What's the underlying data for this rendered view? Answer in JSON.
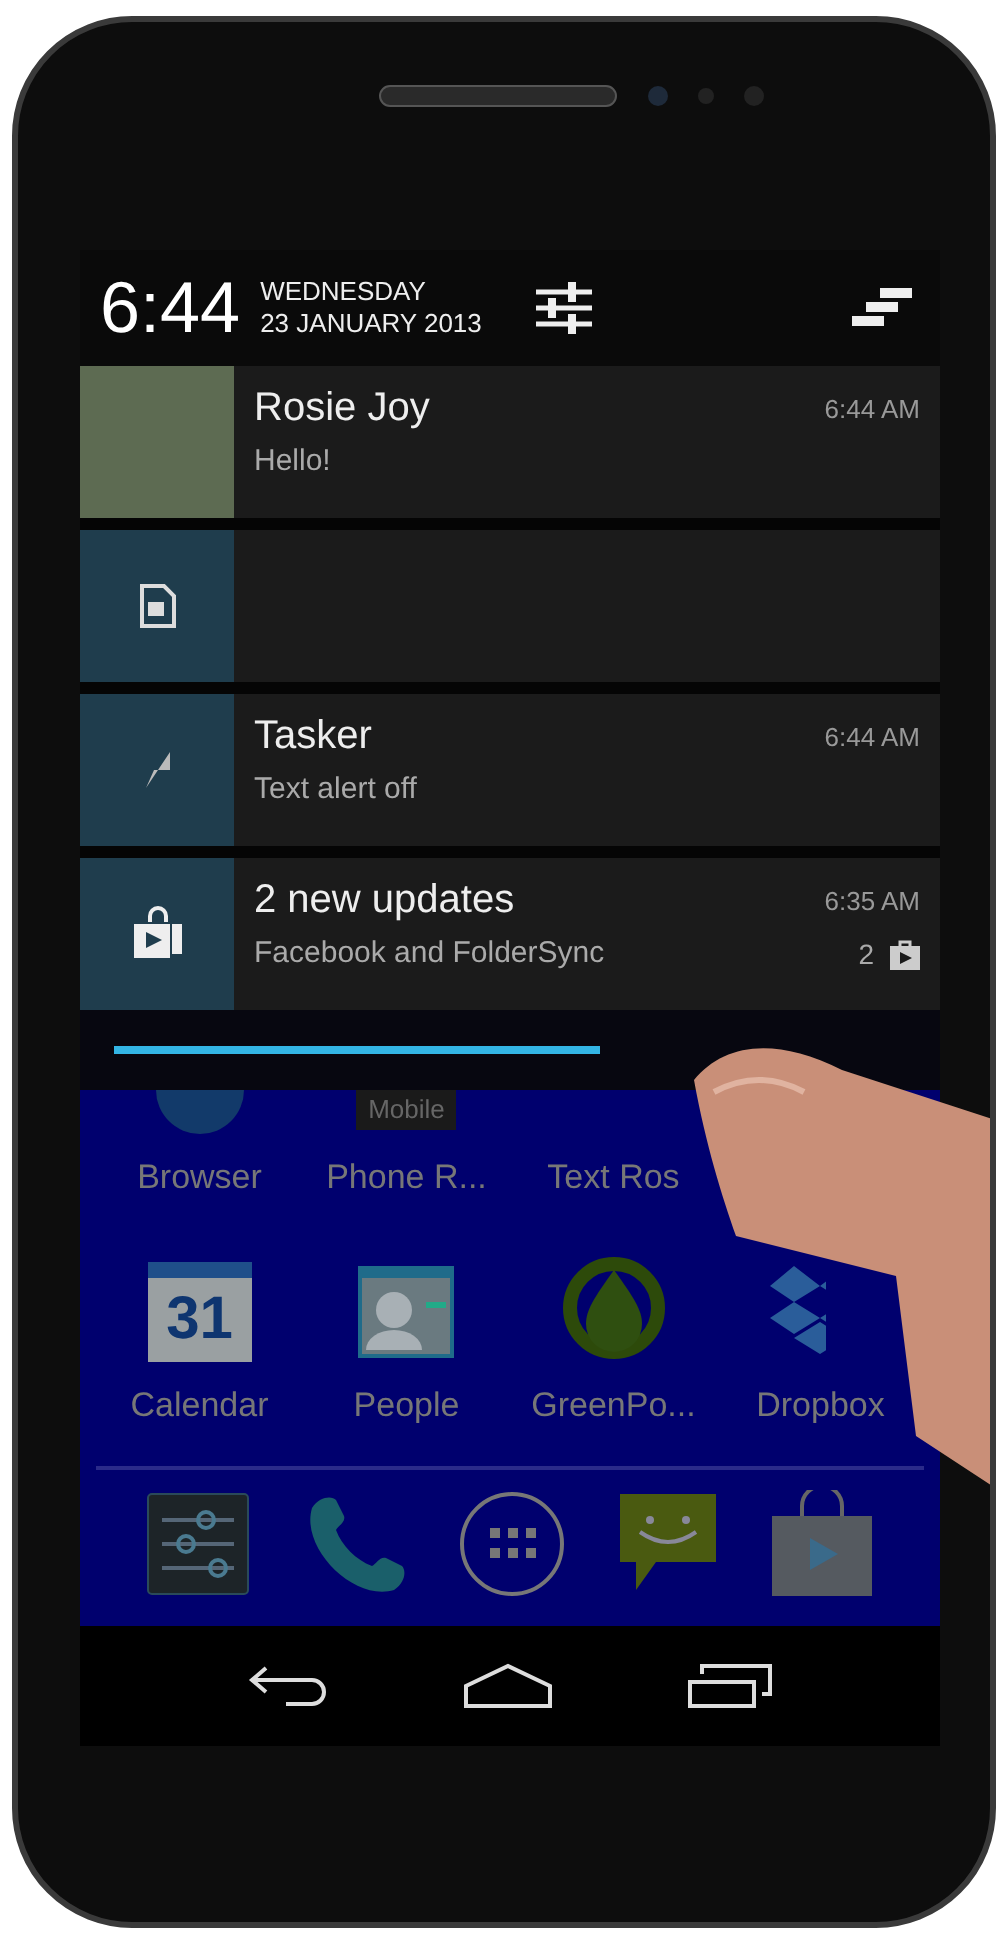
{
  "status_header": {
    "time": "6:44",
    "day": "WEDNESDAY",
    "date": "23 JANUARY 2013"
  },
  "notifications": [
    {
      "kind": "contact",
      "title": "Rosie Joy",
      "text": "Hello!",
      "time": "6:44 AM"
    },
    {
      "kind": "blank"
    },
    {
      "kind": "app",
      "title": "Tasker",
      "text": "Text alert off",
      "time": "6:44 AM"
    },
    {
      "kind": "store",
      "title": "2 new updates",
      "text": "Facebook and FolderSync",
      "time": "6:35 AM",
      "count": "2"
    }
  ],
  "home_rows": [
    [
      {
        "kind": "globe",
        "label": "Browser"
      },
      {
        "kind": "tile",
        "label": "Phone R...",
        "icon_caption": "Mobile"
      },
      {
        "label": "Text Ros"
      }
    ],
    [
      {
        "kind": "calendar",
        "label": "Calendar",
        "icon_text": "31"
      },
      {
        "kind": "people",
        "label": "People"
      },
      {
        "kind": "drop",
        "label": "GreenPo..."
      },
      {
        "kind": "box",
        "label": "Dropbox"
      }
    ]
  ],
  "dock": [
    {
      "kind": "settings"
    },
    {
      "kind": "phone"
    },
    {
      "kind": "launcher"
    },
    {
      "kind": "messaging"
    },
    {
      "kind": "store"
    }
  ],
  "nav": [
    {
      "kind": "back"
    },
    {
      "kind": "home"
    },
    {
      "kind": "recents"
    }
  ]
}
